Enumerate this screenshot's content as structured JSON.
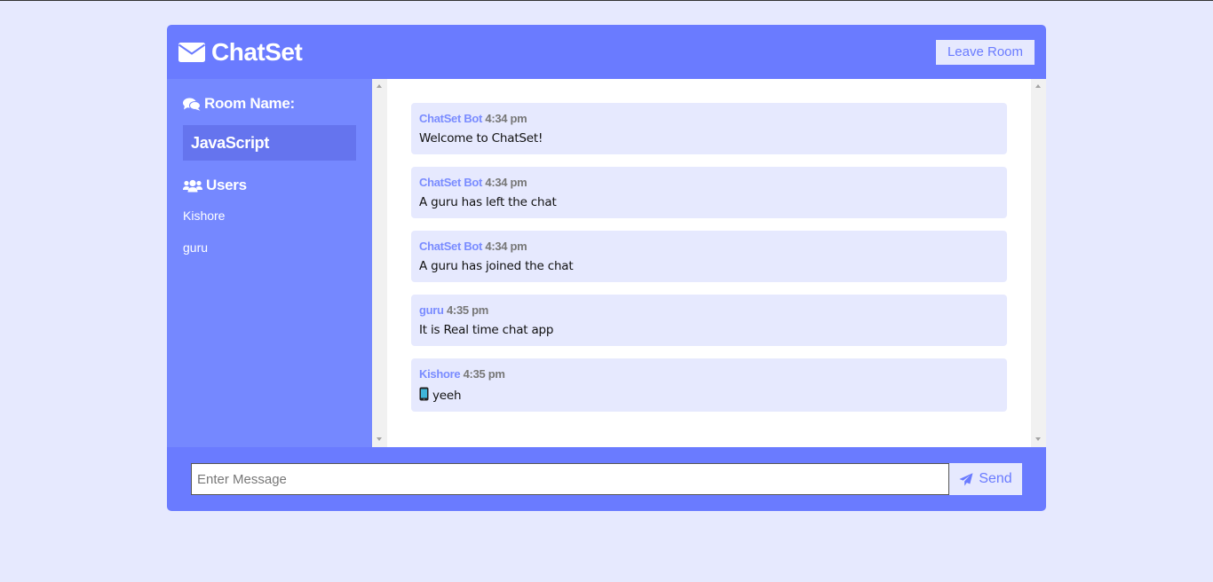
{
  "header": {
    "title": "ChatSet",
    "leave_label": "Leave Room"
  },
  "sidebar": {
    "room_heading": "Room Name:",
    "room_name": "JavaScript",
    "users_heading": "Users",
    "users": [
      "Kishore",
      "guru"
    ]
  },
  "messages": [
    {
      "user": "ChatSet Bot",
      "time": "4:34 pm",
      "text": "Welcome to ChatSet!"
    },
    {
      "user": "ChatSet Bot",
      "time": "4:34 pm",
      "text": "A guru has left the chat"
    },
    {
      "user": "ChatSet Bot",
      "time": "4:34 pm",
      "text": "A guru has joined the chat"
    },
    {
      "user": "guru",
      "time": "4:35 pm",
      "text": "It is Real time chat app"
    },
    {
      "user": "Kishore",
      "time": "4:35 pm",
      "text": "yeeh"
    }
  ],
  "form": {
    "placeholder": "Enter Message",
    "send_label": "Send"
  },
  "icons": {
    "brand": "envelope-icon",
    "room": "comments-icon",
    "users": "users-icon",
    "send": "paper-plane-icon",
    "emoji": "mobile-phone-icon"
  },
  "colors": {
    "accent": "#6a7bff",
    "sidebar": "#7588ff",
    "background": "#e6e9fe"
  }
}
